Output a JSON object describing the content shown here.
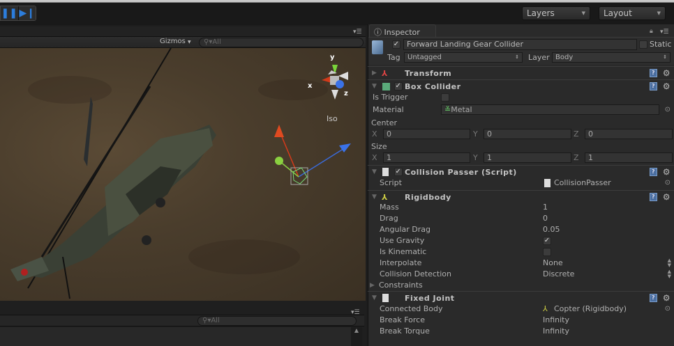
{
  "toolbar": {
    "layers_label": "Layers",
    "layout_label": "Layout",
    "pause_icon": "pause-icon",
    "step_icon": "step-icon"
  },
  "scene": {
    "gizmos_label": "Gizmos",
    "search_placeholder": "All",
    "view_mode": "Iso",
    "axis_x": "x",
    "axis_y": "y",
    "axis_z": "z"
  },
  "bottom_panel": {
    "search_placeholder": "All"
  },
  "inspector": {
    "tab_label": "Inspector",
    "object_name": "Forward Landing Gear Collider",
    "active": true,
    "static_label": "Static",
    "tag_label": "Tag",
    "tag_value": "Untagged",
    "layer_label": "Layer",
    "layer_value": "Body",
    "transform": {
      "title": "Transform"
    },
    "box_collider": {
      "title": "Box Collider",
      "is_trigger_label": "Is Trigger",
      "material_label": "Material",
      "material_value": "Metal",
      "center_label": "Center",
      "center": {
        "x": "0",
        "y": "0",
        "z": "0"
      },
      "size_label": "Size",
      "size": {
        "x": "1",
        "y": "1",
        "z": "1"
      },
      "x_label": "X",
      "y_label": "Y",
      "z_label": "Z"
    },
    "collision_passer": {
      "title": "Collision Passer (Script)",
      "script_label": "Script",
      "script_value": "CollisionPasser"
    },
    "rigidbody": {
      "title": "Rigidbody",
      "mass_label": "Mass",
      "mass": "1",
      "drag_label": "Drag",
      "drag": "0",
      "angular_drag_label": "Angular Drag",
      "angular_drag": "0.05",
      "use_gravity_label": "Use Gravity",
      "use_gravity": true,
      "is_kinematic_label": "Is Kinematic",
      "is_kinematic": false,
      "interpolate_label": "Interpolate",
      "interpolate": "None",
      "collision_detection_label": "Collision Detection",
      "collision_detection": "Discrete",
      "constraints_label": "Constraints"
    },
    "fixed_joint": {
      "title": "Fixed Joint",
      "connected_body_label": "Connected Body",
      "connected_body": "Copter (Rigidbody)",
      "break_force_label": "Break Force",
      "break_force": "Infinity",
      "break_torque_label": "Break Torque",
      "break_torque": "Infinity"
    }
  }
}
